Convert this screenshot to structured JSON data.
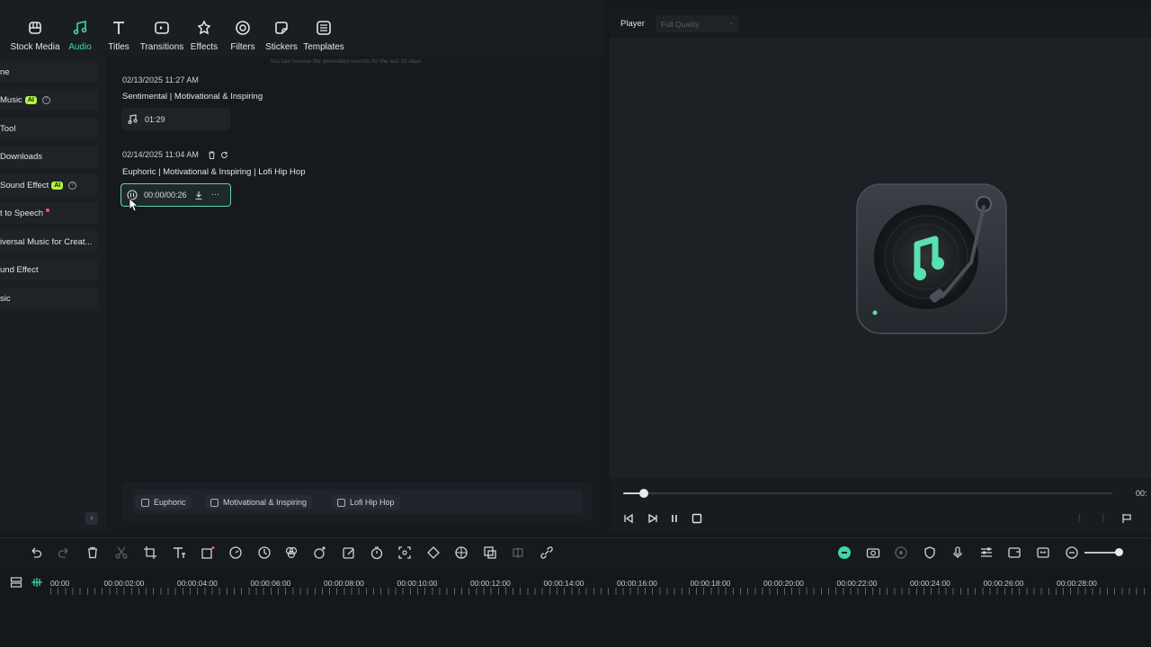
{
  "toolbar": {
    "tabs": [
      {
        "label": "Stock Media",
        "icon": "stock-media-icon"
      },
      {
        "label": "Audio",
        "icon": "audio-note-icon",
        "active": true
      },
      {
        "label": "Titles",
        "icon": "titles-icon"
      },
      {
        "label": "Transitions",
        "icon": "transitions-icon"
      },
      {
        "label": "Effects",
        "icon": "effects-icon"
      },
      {
        "label": "Filters",
        "icon": "filters-icon"
      },
      {
        "label": "Stickers",
        "icon": "stickers-icon"
      },
      {
        "label": "Templates",
        "icon": "templates-icon"
      }
    ],
    "accent_color": "#3fd6a8"
  },
  "sidebar": {
    "items": [
      {
        "label": "ne"
      },
      {
        "label": "Music",
        "badge": "AI",
        "help": "?"
      },
      {
        "label": "Tool"
      },
      {
        "label": "Downloads"
      },
      {
        "label": "Sound Effect",
        "badge": "AI",
        "help": "?"
      },
      {
        "label": "t to Speech",
        "new_dot": true
      },
      {
        "label": "iversal Music for Creat..."
      },
      {
        "label": "und Effect"
      },
      {
        "label": "sic"
      }
    ],
    "collapse_glyph": "‹"
  },
  "records": {
    "hint": "You can browse the generated records for the last 30 days.",
    "entries": [
      {
        "timestamp": "02/13/2025 11:27 AM",
        "title": "Sentimental | Motivational & Inspiring",
        "clip_time": "01:29"
      },
      {
        "timestamp": "02/14/2025 11:04 AM",
        "title": "Euphoric | Motivational & Inspiring | Lofi Hip Hop",
        "clip_time": "00:00/00:26",
        "clip_more": "···"
      }
    ],
    "tags": [
      "Euphoric",
      "Motivational & Inspiring",
      "Lofi Hip Hop"
    ]
  },
  "player": {
    "label": "Player",
    "quality": "Full Quality",
    "timecode": "00:",
    "progress": 0.02,
    "brackets": [
      "{",
      "}"
    ]
  },
  "timeline": {
    "ruler_labels": [
      "00:00",
      "00:00:02:00",
      "00:00:04:00",
      "00:00:06:00",
      "00:00:08:00",
      "00:00:10:00",
      "00:00:12:00",
      "00:00:14:00",
      "00:00:16:00",
      "00:00:18:00",
      "00:00:20:00",
      "00:00:22:00",
      "00:00:24:00",
      "00:00:26:00",
      "00:00:28:00"
    ]
  }
}
